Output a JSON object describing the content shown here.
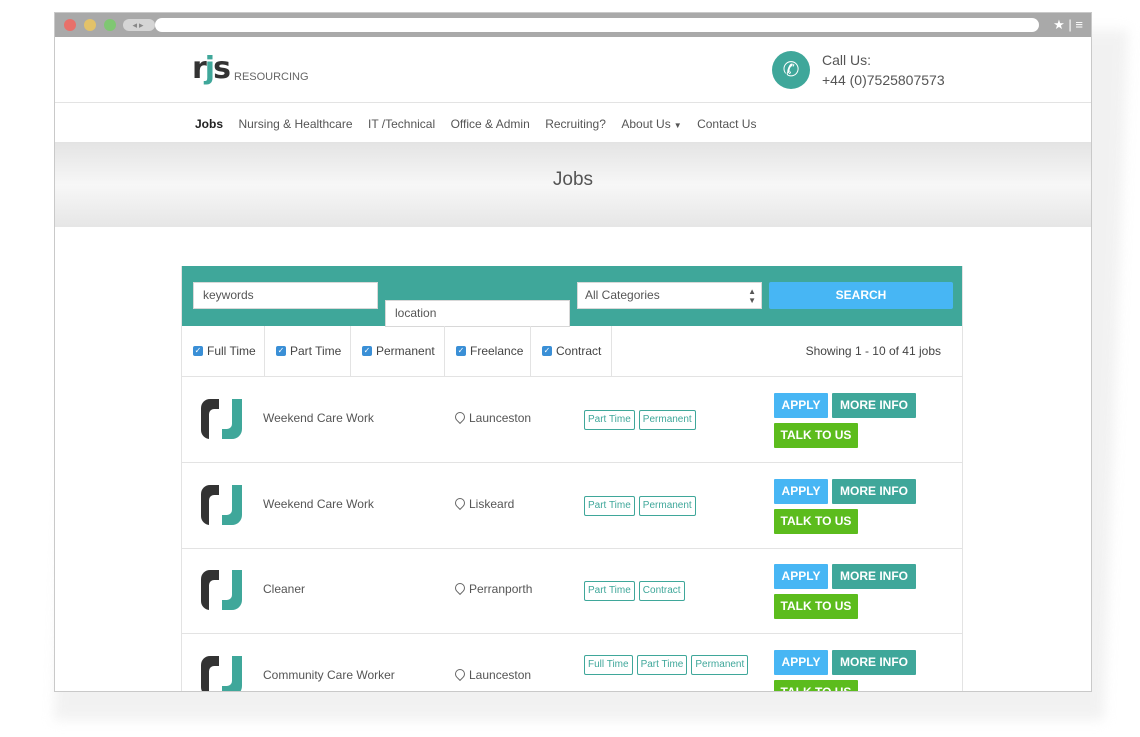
{
  "header": {
    "logo_mark_a": "r",
    "logo_mark_j": "j",
    "logo_mark_b": "s",
    "logo_text": "RESOURCING",
    "call_label": "Call Us:",
    "call_number": "+44 (0)7525807573",
    "phone_icon": "phone-icon"
  },
  "nav": {
    "items": [
      "Jobs",
      "Nursing & Healthcare",
      "IT /Technical",
      "Office & Admin",
      "Recruiting?",
      "About Us",
      "Contact Us"
    ]
  },
  "hero": {
    "title": "Jobs"
  },
  "search": {
    "keywords_value": "keywords",
    "location_value": "location",
    "category_value": "All Categories",
    "button_label": "SEARCH"
  },
  "filters": {
    "items": [
      "Full Time",
      "Part Time",
      "Permanent",
      "Freelance",
      "Contract"
    ],
    "showing": "Showing 1 - 10 of 41 jobs"
  },
  "jobs": [
    {
      "title": "Weekend Care Work",
      "location": "Launceston",
      "tags": [
        "Part Time",
        "Permanent"
      ]
    },
    {
      "title": "Weekend Care Work",
      "location": "Liskeard",
      "tags": [
        "Part Time",
        "Permanent"
      ]
    },
    {
      "title": "Cleaner",
      "location": "Perranporth",
      "tags": [
        "Part Time",
        "Contract"
      ]
    },
    {
      "title": "Community Care Worker",
      "location": "Launceston",
      "tags": [
        "Full Time",
        "Part Time",
        "Permanent"
      ]
    }
  ],
  "job_buttons": {
    "apply": "APPLY",
    "more": "MORE INFO",
    "talk": "TALK TO US"
  },
  "colors": {
    "brand_teal": "#3fa79a",
    "apply_blue": "#47b6f4",
    "talk_green": "#5cbc1d"
  }
}
